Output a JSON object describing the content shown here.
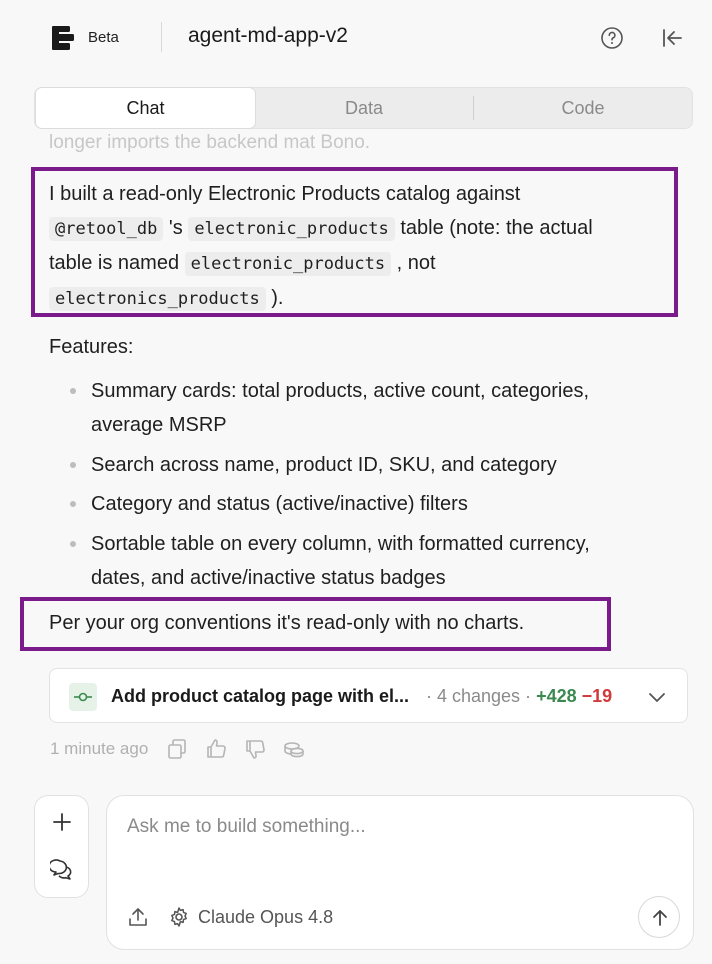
{
  "header": {
    "beta_label": "Beta",
    "app_title": "agent-md-app-v2",
    "help_icon": "help-circle-icon",
    "collapse_icon": "collapse-left-icon"
  },
  "tabs": [
    {
      "label": "Chat",
      "active": true
    },
    {
      "label": "Data",
      "active": false
    },
    {
      "label": "Code",
      "active": false
    }
  ],
  "message": {
    "faded_line": "longer imports the backend mat Bono.",
    "intro": {
      "t1": "I built a read-only Electronic Products catalog against",
      "c1": "@retool_db",
      "t2": "'s",
      "c2": "electronic_products",
      "t3": "table (note: the actual",
      "t4": "table is named",
      "c3": "electronic_products",
      "t5": ", not",
      "c4": "electronics_products",
      "t6": ")."
    },
    "features_heading": "Features:",
    "features": [
      {
        "line1": "Summary cards: total products, active count, categories,",
        "line2": "average MSRP"
      },
      {
        "line1": "Search across name, product ID, SKU, and category",
        "line2": ""
      },
      {
        "line1": "Category and status (active/inactive) filters",
        "line2": ""
      },
      {
        "line1": "Sortable table on every column, with formatted currency,",
        "line2": "dates, and active/inactive status badges"
      }
    ],
    "closing": "Per your org conventions it's read-only with no charts."
  },
  "change_card": {
    "title": "Add product catalog page with el...",
    "changes": "· 4 changes ·",
    "additions": "+428",
    "deletions": "−19"
  },
  "meta": {
    "time": "1 minute ago",
    "icons": [
      "copy-icon",
      "thumbs-up-icon",
      "thumbs-down-icon",
      "database-icon"
    ]
  },
  "composer": {
    "placeholder": "Ask me to build something...",
    "model_label": "Claude Opus 4.8"
  },
  "colors": {
    "highlight_box": "#7b1a8a",
    "additions": "#3a8a4f",
    "deletions": "#d03a3a"
  }
}
